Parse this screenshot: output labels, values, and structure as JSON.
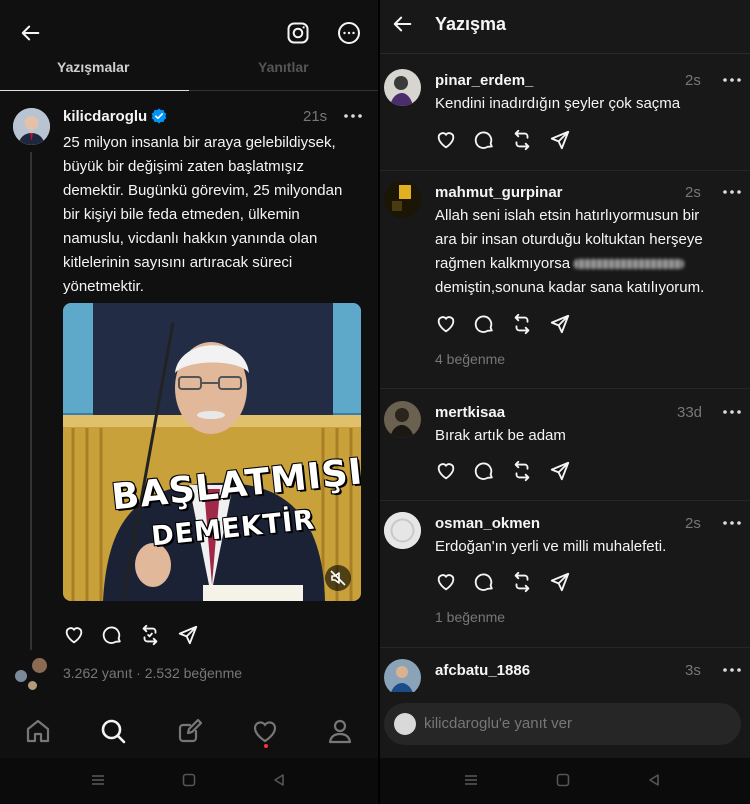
{
  "left": {
    "tabs": [
      "Yazışmalar",
      "Yanıtlar"
    ],
    "post": {
      "author": "kilicdaroglu",
      "time": "21s",
      "lines": [
        "25 milyon insanla bir araya gelebildiysek,",
        "büyük bir değişimi zaten başlatmışız",
        "demektir. Bugünkü görevim, 25 milyondan",
        "bir kişiyi bile feda etmeden, ülkemin",
        "namuslu, vicdanlı hakkın yanında olan",
        "kitlelerinin sayısını artıracak süreci",
        "yönetmektir."
      ],
      "media_caption_1": "BAŞLATMIŞIZ",
      "media_caption_2": "DEMEKTİR",
      "stats": "3.262 yanıt · 2.532 beğenme"
    }
  },
  "right": {
    "title": "Yazışma",
    "comments": [
      {
        "user": "pinar_erdem_",
        "time": "2s",
        "text": "Kendini inadırdığın şeyler çok saçma",
        "likes": ""
      },
      {
        "user": "mahmut_gurpinar",
        "time": "2s",
        "text_1": "Allah seni islah etsin hatırlıyormusun bir",
        "text_2": "ara bir insan oturduğu koltuktan herşeye",
        "text_3": "rağmen kalkmıyorsa",
        "text_4": "demiştin,sonuna kadar sana katılıyorum.",
        "likes": "4 beğenme"
      },
      {
        "user": "mertkisaa",
        "time": "33d",
        "text": "Bırak artık be adam",
        "likes": ""
      },
      {
        "user": "osman_okmen",
        "time": "2s",
        "text": "Erdoğan'ın yerli ve milli muhalefeti.",
        "likes": "1 beğenme"
      },
      {
        "user": "afcbatu_1886",
        "time": "3s",
        "text": "",
        "likes": ""
      }
    ],
    "reply_placeholder": "kilicdaroglu'e yanıt ver"
  },
  "colors": {
    "background": "#101010",
    "panel_right": "#181818",
    "verified": "#0095f6",
    "notification": "#ff3040"
  },
  "icons": [
    "back-arrow-icon",
    "instagram-icon",
    "more-icon",
    "verified-icon",
    "heart-icon",
    "comment-icon",
    "repost-icon",
    "share-icon",
    "home-icon",
    "search-icon",
    "compose-icon",
    "activity-icon",
    "profile-icon",
    "mute-icon"
  ]
}
